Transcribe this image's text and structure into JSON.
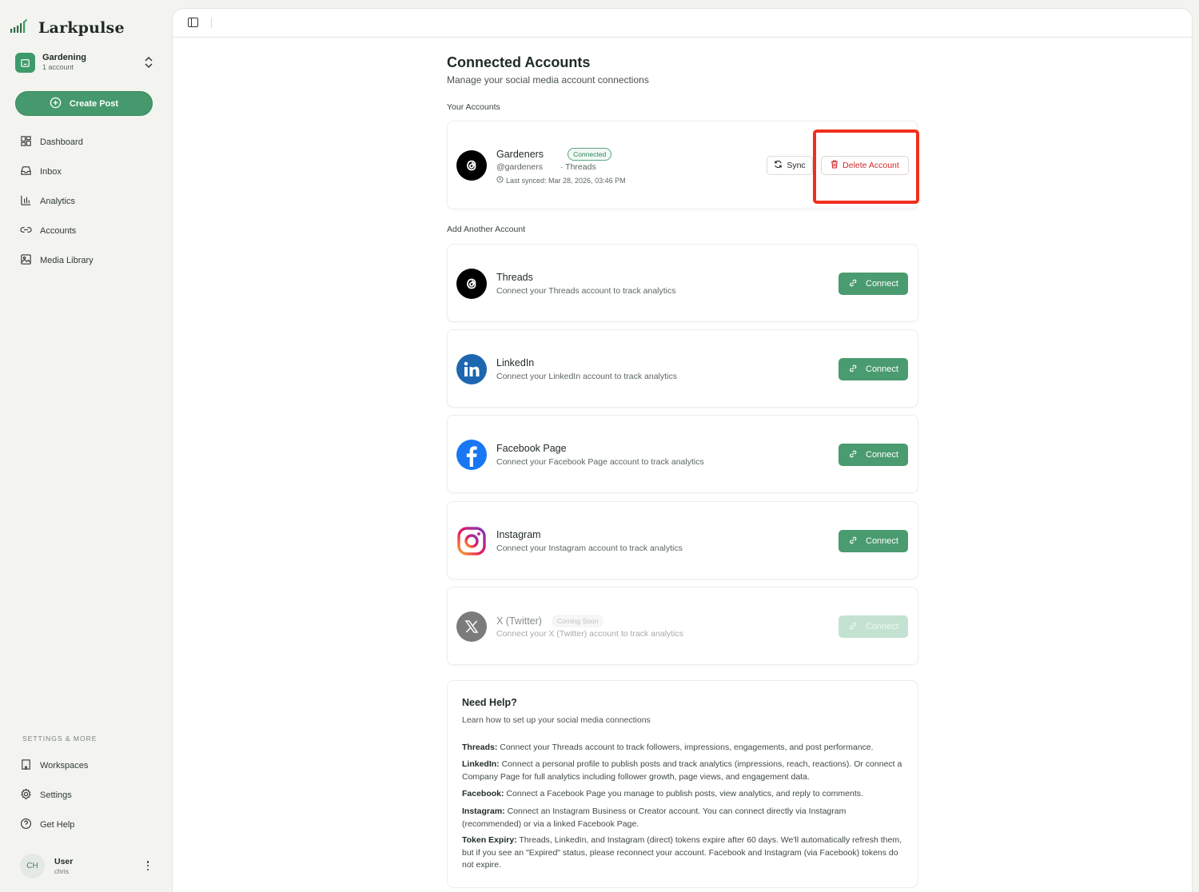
{
  "brand": {
    "name": "Larkpulse"
  },
  "workspace": {
    "name": "Gardening",
    "count": "1 account"
  },
  "sidebar": {
    "create_label": "Create Post",
    "items": [
      {
        "label": "Dashboard",
        "icon": "grid-icon"
      },
      {
        "label": "Inbox",
        "icon": "inbox-icon"
      },
      {
        "label": "Analytics",
        "icon": "bar-chart-icon"
      },
      {
        "label": "Accounts",
        "icon": "link-icon"
      },
      {
        "label": "Media Library",
        "icon": "image-icon"
      }
    ],
    "settings_heading": "SETTINGS & MORE",
    "settings_items": [
      {
        "label": "Workspaces",
        "icon": "building-icon"
      },
      {
        "label": "Settings",
        "icon": "gear-icon"
      },
      {
        "label": "Get Help",
        "icon": "help-circle-icon"
      }
    ]
  },
  "user": {
    "initials": "CH",
    "name": "User",
    "handle": "chris"
  },
  "page": {
    "title": "Connected Accounts",
    "subtitle": "Manage your social media account connections",
    "your_accounts_label": "Your Accounts",
    "add_label": "Add Another Account"
  },
  "connected_account": {
    "name": "Gardeners",
    "status": "Connected",
    "handle": "@gardeners",
    "platform": "· Threads",
    "last_synced": "Last synced: Mar 28, 2026, 03:46 PM",
    "sync_label": "Sync",
    "delete_label": "Delete Account"
  },
  "platforms": [
    {
      "name": "Threads",
      "desc": "Connect your Threads account to track analytics",
      "button": "Connect"
    },
    {
      "name": "LinkedIn",
      "desc": "Connect your LinkedIn account to track analytics",
      "button": "Connect"
    },
    {
      "name": "Facebook Page",
      "desc": "Connect your Facebook Page account to track analytics",
      "button": "Connect"
    },
    {
      "name": "Instagram",
      "desc": "Connect your Instagram account to track analytics",
      "button": "Connect"
    },
    {
      "name": "X (Twitter)",
      "badge": "Coming Soon",
      "desc": "Connect your X (Twitter) account to track analytics",
      "button": "Connect"
    }
  ],
  "help": {
    "title": "Need Help?",
    "subtitle": "Learn how to set up your social media connections",
    "items": [
      {
        "label": "Threads:",
        "text": " Connect your Threads account to track followers, impressions, engagements, and post performance."
      },
      {
        "label": "LinkedIn:",
        "text": " Connect a personal profile to publish posts and track analytics (impressions, reach, reactions). Or connect a Company Page for full analytics including follower growth, page views, and engagement data."
      },
      {
        "label": "Facebook:",
        "text": " Connect a Facebook Page you manage to publish posts, view analytics, and reply to comments."
      },
      {
        "label": "Instagram:",
        "text": " Connect an Instagram Business or Creator account. You can connect directly via Instagram (recommended) or via a linked Facebook Page."
      },
      {
        "label": "Token Expiry:",
        "text": " Threads, LinkedIn, and Instagram (direct) tokens expire after 60 days. We'll automatically refresh them, but if you see an \"Expired\" status, please reconnect your account. Facebook and Instagram (via Facebook) tokens do not expire."
      }
    ]
  },
  "colors": {
    "accent": "#45996c",
    "danger": "#d22a2a",
    "highlight": "#f0301c"
  }
}
